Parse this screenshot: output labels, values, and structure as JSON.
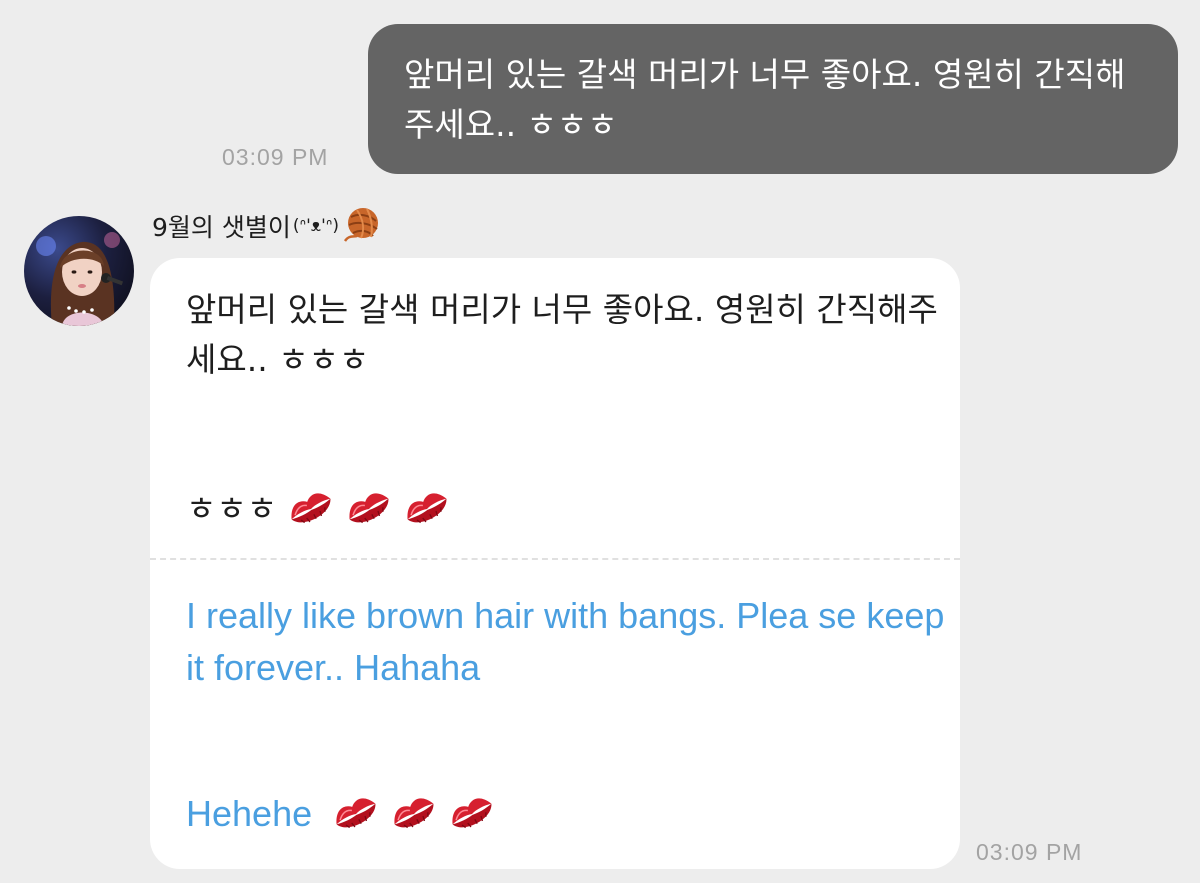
{
  "sent_message": {
    "text": "앞머리 있는 갈색 머리가 너무 좋아요. 영원히 간직해주세요.. ㅎㅎㅎ",
    "time": "03:09 PM"
  },
  "received_message": {
    "sender_name": "9월의 샛별이",
    "sender_kaomoji": "(ᐢ'ᴥ'ᐢ)",
    "sender_badge_icon": "yarn-ball-icon",
    "original_text": "앞머리 있는 갈색 머리가 너무 좋아요. 영원히 간직해주세요.. ㅎㅎㅎ",
    "original_laugh": "ㅎㅎㅎ",
    "translation_text": "I really like brown hair with bangs. Plea se keep it forever.. Hahaha",
    "translation_laugh": "Hehehe",
    "emoji_icon": "kiss-mark-icon",
    "emoji_count": 3,
    "time": "03:09 PM"
  },
  "colors": {
    "background": "#ededed",
    "sent_bubble": "#646464",
    "received_bubble": "#ffffff",
    "translation_text": "#4a9fe0",
    "timestamp": "#a3a3a3"
  }
}
